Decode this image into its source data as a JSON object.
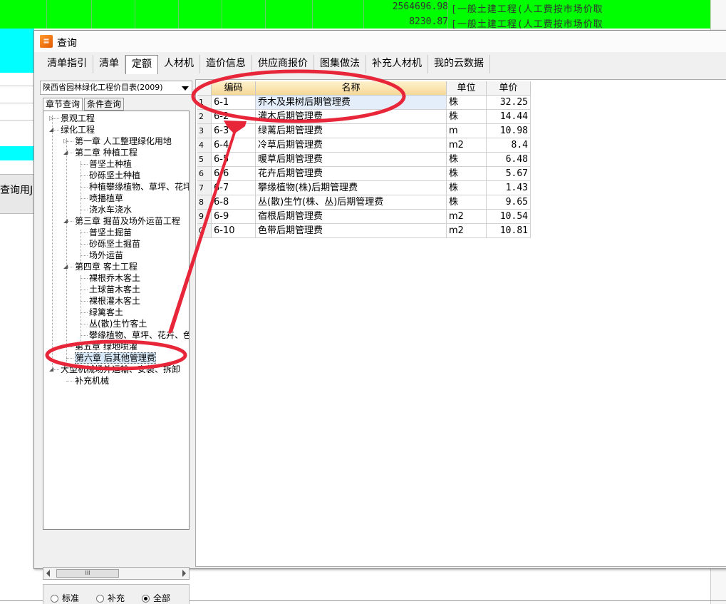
{
  "background": {
    "rows": [
      {
        "amount": "2564696.98",
        "desc": "[一般土建工程(人工费按市场价取"
      },
      {
        "amount": "8230.87",
        "desc": "[一般土建工程(人工费按市场价取"
      }
    ],
    "left_label": "查询用J"
  },
  "dialog": {
    "title": "查询",
    "tabs": [
      "清单指引",
      "清单",
      "定额",
      "人材机",
      "造价信息",
      "供应商报价",
      "图集做法",
      "补充人材机",
      "我的云数据"
    ],
    "active_tab": "定额"
  },
  "left": {
    "combo_value": "陕西省园林绿化工程价目表(2009)",
    "subtabs": [
      "章节查询",
      "条件查询"
    ],
    "tree": [
      {
        "label": "景观工程",
        "level": 0,
        "toggle": "▷"
      },
      {
        "label": "绿化工程",
        "level": 0,
        "toggle": "◢"
      },
      {
        "label": "第一章 人工整理绿化用地",
        "level": 1,
        "toggle": "▷"
      },
      {
        "label": "第二章 种植工程",
        "level": 1,
        "toggle": "◢"
      },
      {
        "label": "普坚土种植",
        "level": 2
      },
      {
        "label": "砂砾坚土种植",
        "level": 2
      },
      {
        "label": "种植攀缘植物、草坪、花坪",
        "level": 2
      },
      {
        "label": "喷播植草",
        "level": 2
      },
      {
        "label": "浇水车浇水",
        "level": 2
      },
      {
        "label": "第三章 掘苗及场外运苗工程",
        "level": 1,
        "toggle": "◢"
      },
      {
        "label": "普坚土掘苗",
        "level": 2
      },
      {
        "label": "砂砾坚土掘苗",
        "level": 2
      },
      {
        "label": "场外运苗",
        "level": 2
      },
      {
        "label": "第四章 客土工程",
        "level": 1,
        "toggle": "◢"
      },
      {
        "label": "裸根乔木客土",
        "level": 2
      },
      {
        "label": "土球苗木客土",
        "level": 2
      },
      {
        "label": "裸根灌木客土",
        "level": 2
      },
      {
        "label": "绿篱客土",
        "level": 2
      },
      {
        "label": "丛(散)生竹客土",
        "level": 2
      },
      {
        "label": "攀缘植物、草坪、花卉、色",
        "level": 2
      },
      {
        "label": "第五章 绿地喷灌",
        "level": 1
      },
      {
        "label": "第六章 后其他管理费",
        "level": 1,
        "selected": true
      },
      {
        "label": "大型机械场外运输、安装、拆卸",
        "level": 0,
        "toggle": "◢"
      },
      {
        "label": "补充机械",
        "level": 1
      }
    ],
    "scroll_thumb": "III",
    "radios": [
      {
        "label": "标准",
        "checked": false
      },
      {
        "label": "补充",
        "checked": false
      },
      {
        "label": "全部",
        "checked": true
      }
    ]
  },
  "grid": {
    "headers": [
      "编码",
      "名称",
      "单位",
      "单价"
    ],
    "rows": [
      {
        "rn": "1",
        "code": "6-1",
        "name": "乔木及果树后期管理费",
        "unit": "株",
        "price": "32.25",
        "selected": true
      },
      {
        "rn": "2",
        "code": "6-2",
        "name": "灌木后期管理费",
        "unit": "株",
        "price": "14.44"
      },
      {
        "rn": "3",
        "code": "6-3",
        "name": "绿蓠后期管理费",
        "unit": "m",
        "price": "10.98"
      },
      {
        "rn": "4",
        "code": "6-4",
        "name": "冷草后期管理费",
        "unit": "m2",
        "price": "8.4"
      },
      {
        "rn": "5",
        "code": "6-5",
        "name": "暖草后期管理费",
        "unit": "株",
        "price": "6.48"
      },
      {
        "rn": "6",
        "code": "6-6",
        "name": "花卉后期管理费",
        "unit": "株",
        "price": "5.67"
      },
      {
        "rn": "7",
        "code": "6-7",
        "name": "攀缘植物(株)后期管理费",
        "unit": "株",
        "price": "1.43"
      },
      {
        "rn": "8",
        "code": "6-8",
        "name": "丛(散)生竹(株、丛)后期管理费",
        "unit": "株",
        "price": "9.65"
      },
      {
        "rn": "9",
        "code": "6-9",
        "name": "宿根后期管理费",
        "unit": "m2",
        "price": "10.54"
      },
      {
        "rn": "0",
        "code": "6-10",
        "name": "色带后期管理费",
        "unit": "m2",
        "price": "10.81"
      }
    ]
  },
  "colors": {
    "annotation": "#e8263a",
    "header": "#f5d896",
    "bg_green": "#00ff00",
    "bg_cyan": "#00ffff"
  }
}
